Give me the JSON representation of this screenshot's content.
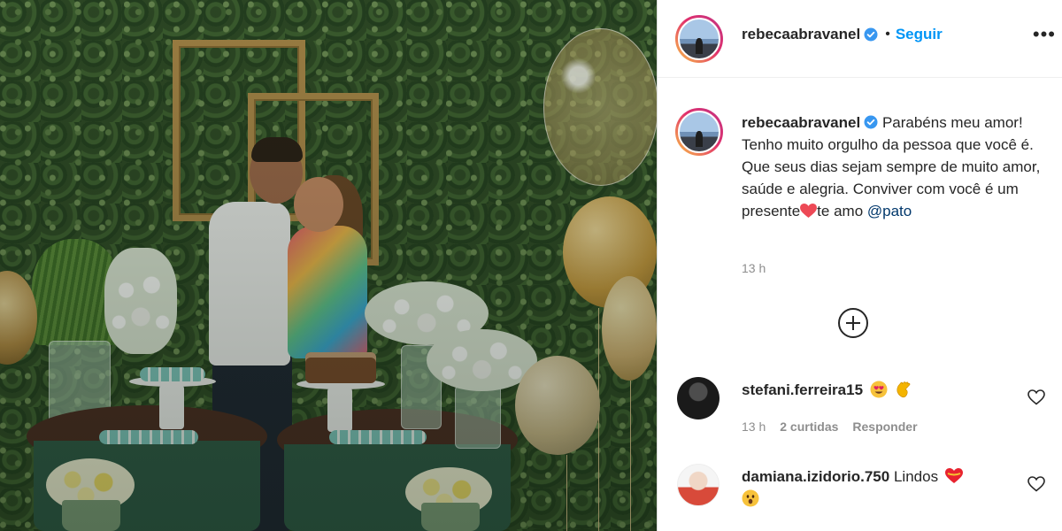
{
  "post": {
    "author": "rebecaabravanel",
    "follow_label": "Seguir",
    "separator": "•",
    "more_label": "•••",
    "caption_text": "Parabéns meu amor! Tenho muito orgulho da pessoa que você é. Que seus dias sejam sempre de muito amor, saúde e alegria. Conviver com você é um presente",
    "caption_after_heart": "te amo ",
    "mention": "@pato",
    "caption_time": "13 h",
    "colors": {
      "link": "#0095f6",
      "mention": "#00376b",
      "verified": "#3897f0",
      "heart": "#ed4956",
      "muted": "#8e8e8e"
    }
  },
  "comments": [
    {
      "user": "stefani.ferreira15",
      "text": "",
      "emojis": [
        "heart-eyes-emoji",
        "clapping-hands-emoji"
      ],
      "time": "13 h",
      "likes": "2 curtidas",
      "reply_label": "Responder"
    },
    {
      "user": "damiana.izidorio.750",
      "text": "Lindos",
      "emojis": [
        "heart-emoji",
        "astonished-face-emoji"
      ]
    }
  ],
  "icons": {
    "load_more": "plus-circle-icon",
    "like": "heart-outline-icon",
    "verified": "verified-badge-icon",
    "more": "more-options-icon"
  }
}
